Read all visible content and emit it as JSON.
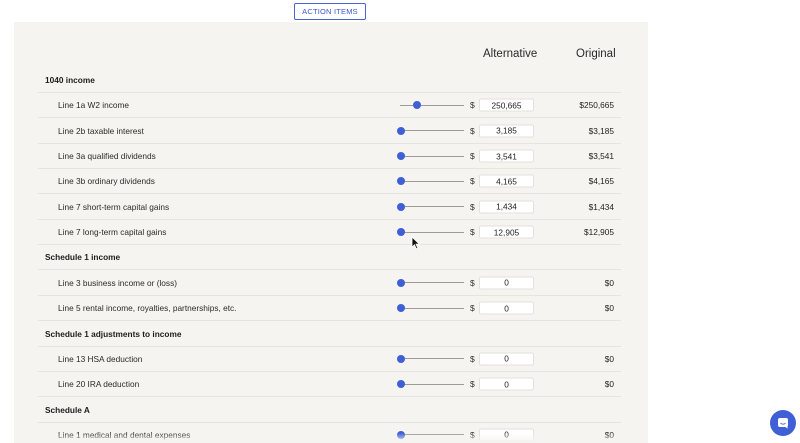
{
  "top_button": {
    "label": "ACTION ITEMS"
  },
  "columns": {
    "alternative": "Alternative",
    "original": "Original"
  },
  "currency_symbol": "$",
  "rows": [
    {
      "type": "section",
      "label": "1040 income"
    },
    {
      "type": "item",
      "label": "Line 1a W2 income",
      "value": "250,665",
      "original": "$250,665",
      "slider_fraction": 0.25
    },
    {
      "type": "item",
      "label": "Line 2b taxable interest",
      "value": "3,185",
      "original": "$3,185",
      "slider_fraction": 0.0
    },
    {
      "type": "item",
      "label": "Line 3a qualified dividends",
      "value": "3,541",
      "original": "$3,541",
      "slider_fraction": 0.0
    },
    {
      "type": "item",
      "label": "Line 3b ordinary dividends",
      "value": "4,165",
      "original": "$4,165",
      "slider_fraction": 0.0
    },
    {
      "type": "item",
      "label": "Line 7 short-term capital gains",
      "value": "1,434",
      "original": "$1,434",
      "slider_fraction": 0.0
    },
    {
      "type": "item",
      "label": "Line 7 long-term capital gains",
      "value": "12,905",
      "original": "$12,905",
      "slider_fraction": 0.0
    },
    {
      "type": "section",
      "label": "Schedule 1 income"
    },
    {
      "type": "item",
      "label": "Line 3 business income or (loss)",
      "value": "0",
      "original": "$0",
      "slider_fraction": 0.0
    },
    {
      "type": "item",
      "label": "Line 5 rental income, royalties, partnerships, etc.",
      "value": "0",
      "original": "$0",
      "slider_fraction": 0.0
    },
    {
      "type": "section",
      "label": "Schedule 1 adjustments to income"
    },
    {
      "type": "item",
      "label": "Line 13 HSA deduction",
      "value": "0",
      "original": "$0",
      "slider_fraction": 0.0
    },
    {
      "type": "item",
      "label": "Line 20 IRA deduction",
      "value": "0",
      "original": "$0",
      "slider_fraction": 0.0
    },
    {
      "type": "section",
      "label": "Schedule A"
    },
    {
      "type": "item",
      "label": "Line 1 medical and dental expenses",
      "value": "0",
      "original": "$0",
      "slider_fraction": 0.0
    }
  ],
  "icons": {
    "cursor": "mouse-pointer-icon",
    "chat": "chat-bubble-icon"
  },
  "colors": {
    "accent": "#3f5fd6",
    "panel_bg": "#f6f4f0"
  }
}
